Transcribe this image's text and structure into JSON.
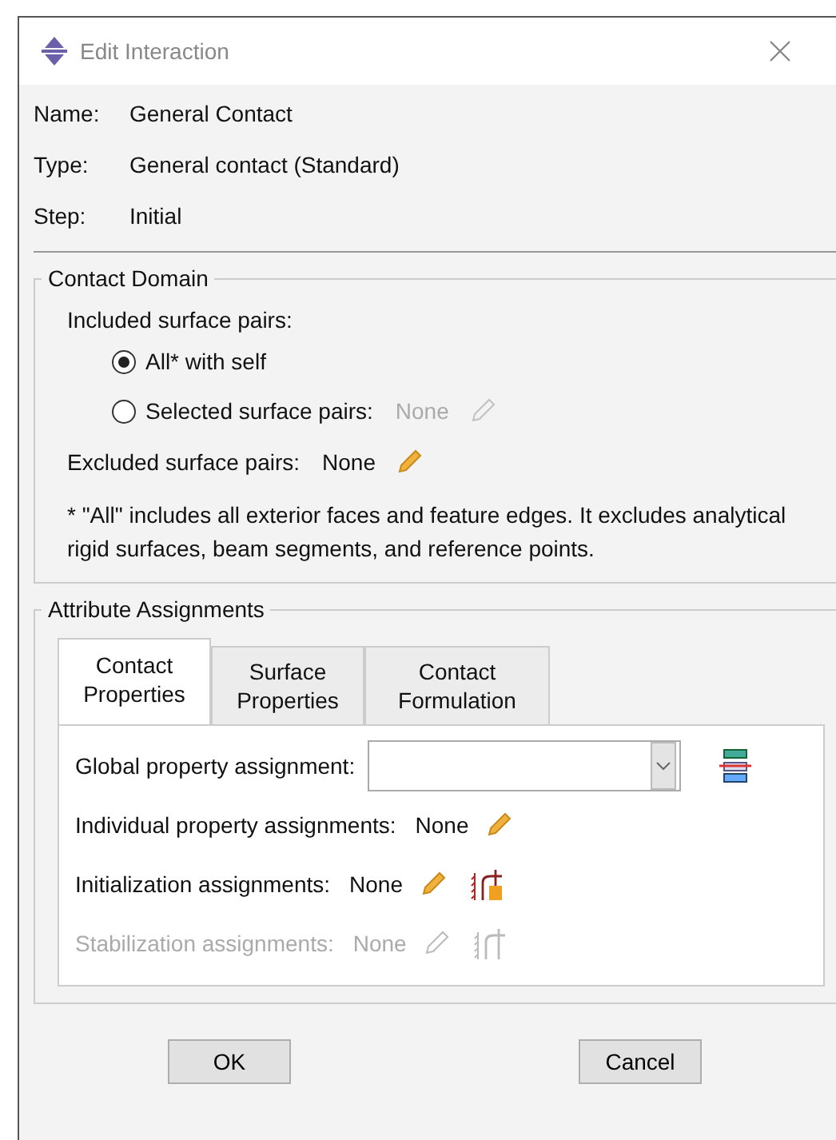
{
  "window": {
    "title": "Edit Interaction"
  },
  "info": [
    {
      "label": "Name:",
      "value": "General Contact"
    },
    {
      "label": "Type:",
      "value": "General contact (Standard)"
    },
    {
      "label": "Step:",
      "value": "Initial"
    }
  ],
  "contact_domain": {
    "title": "Contact Domain",
    "included_label": "Included surface pairs:",
    "options": [
      {
        "label": "All* with self",
        "selected": true
      },
      {
        "label": "Selected surface pairs:",
        "value": "None",
        "selected": false
      }
    ],
    "excluded": {
      "label": "Excluded surface pairs:",
      "value": "None"
    },
    "note": "* \"All\" includes all exterior faces and feature edges. It excludes analytical rigid surfaces, beam segments, and reference points."
  },
  "attribute_assignments": {
    "title": "Attribute Assignments",
    "tabs": [
      {
        "label": "Contact Properties",
        "selected": true
      },
      {
        "label": "Surface Properties",
        "selected": false
      },
      {
        "label": "Contact Formulation",
        "selected": false
      }
    ],
    "rows": [
      {
        "kind": "dropdown",
        "label": "Global property assignment:",
        "disabled": false
      },
      {
        "kind": "edit",
        "label": "Individual property assignments:",
        "value": "None",
        "disabled": false
      },
      {
        "kind": "edit-init",
        "label": "Initialization assignments:",
        "value": "None",
        "disabled": false
      },
      {
        "kind": "edit-init",
        "label": "Stabilization assignments:",
        "value": "None",
        "disabled": true
      }
    ]
  },
  "buttons": [
    "OK",
    "Cancel"
  ]
}
